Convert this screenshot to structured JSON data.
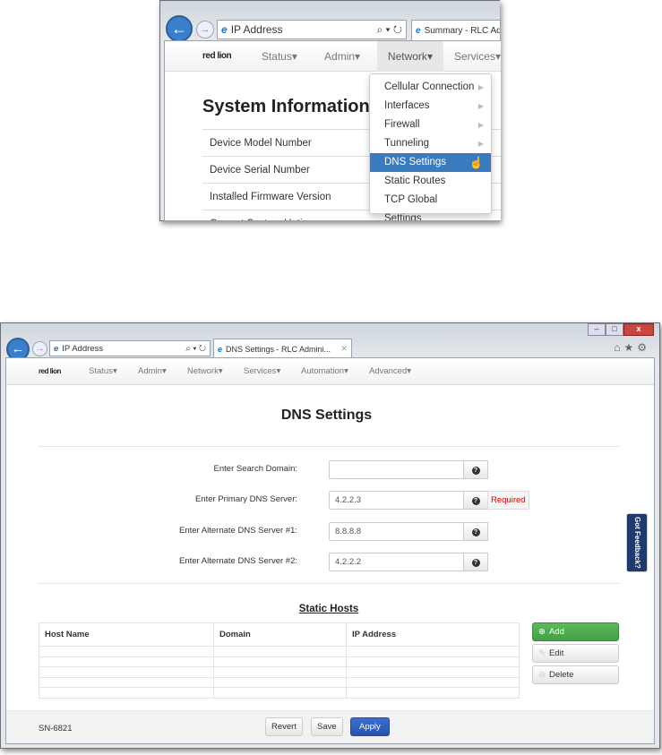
{
  "top": {
    "address": "IP Address",
    "tab": "Summary - RLC Ad",
    "logo": "red lion",
    "nav": [
      "Status",
      "Admin",
      "Network",
      "Services"
    ],
    "heading": "System Information",
    "rows": [
      "Device Model Number",
      "Device Serial Number",
      "Installed Firmware Version",
      "Current System Uptime"
    ],
    "menu": [
      {
        "label": "Cellular Connection",
        "sub": true
      },
      {
        "label": "Interfaces",
        "sub": true
      },
      {
        "label": "Firewall",
        "sub": true
      },
      {
        "label": "Tunneling",
        "sub": true
      },
      {
        "label": "DNS Settings",
        "active": true
      },
      {
        "label": "Static Routes"
      },
      {
        "label": "TCP Global Settings"
      }
    ]
  },
  "bottom": {
    "address": "IP Address",
    "tab": "DNS Settings - RLC Admini...",
    "logo": "red lion",
    "nav": [
      "Status",
      "Admin",
      "Network",
      "Services",
      "Automation",
      "Advanced"
    ],
    "title": "DNS Settings",
    "fields": [
      {
        "label": "Enter Search Domain:",
        "value": ""
      },
      {
        "label": "Enter Primary DNS Server:",
        "value": "4.2.2.3",
        "badge": "Required"
      },
      {
        "label": "Enter Alternate DNS Server #1:",
        "value": "8.8.8.8"
      },
      {
        "label": "Enter Alternate DNS Server #2:",
        "value": "4.2.2.2"
      }
    ],
    "static_hosts": {
      "title": "Static Hosts",
      "columns": [
        "Host Name",
        "Domain",
        "IP Address"
      ]
    },
    "actions": {
      "add": "Add",
      "edit": "Edit",
      "delete": "Delete"
    },
    "footer": {
      "serial": "SN-6821",
      "revert": "Revert",
      "save": "Save",
      "apply": "Apply"
    },
    "feedback": "Got Feedback?"
  },
  "colors": {
    "accent": "#3a7bc0",
    "add": "#4cae4c",
    "apply": "#2d5bb5",
    "required": "#e00000"
  }
}
